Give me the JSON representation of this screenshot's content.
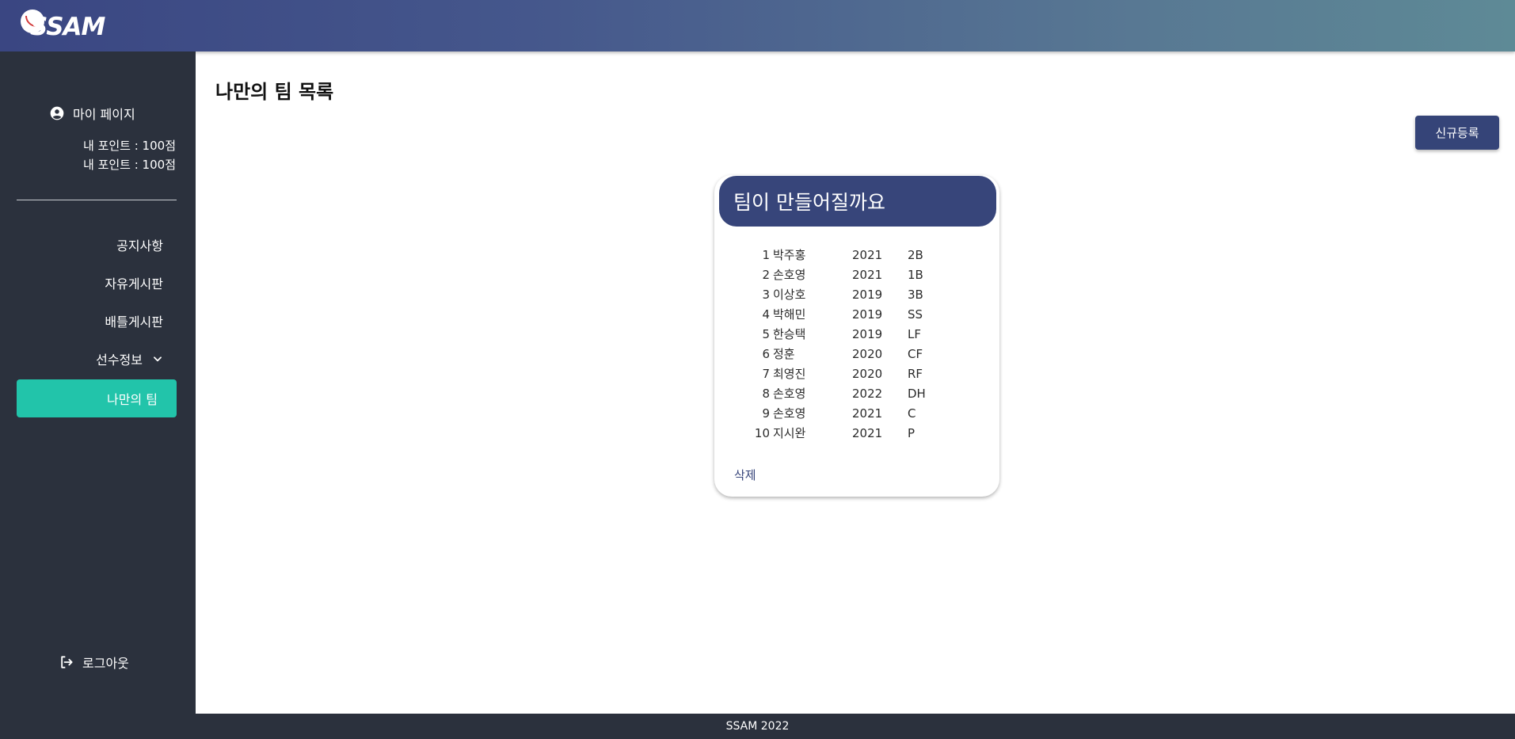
{
  "header": {
    "logo_text": "SSAM"
  },
  "sidebar": {
    "mypage_label": "마이 페이지",
    "points": [
      "내 포인트 : 100점",
      "내 포인트 : 100점"
    ],
    "items": [
      {
        "label": "공지사항"
      },
      {
        "label": "자유게시판"
      },
      {
        "label": "배틀게시판"
      },
      {
        "label": "선수정보"
      },
      {
        "label": "나만의 팀"
      }
    ],
    "logout_label": "로그아웃"
  },
  "main": {
    "title": "나만의 팀 목록",
    "new_button_label": "신규등록",
    "card": {
      "title": "팀이 만들어질까요",
      "players": [
        {
          "no": "1",
          "name": "박주홍",
          "year": "2021",
          "pos": "2B"
        },
        {
          "no": "2",
          "name": "손호영",
          "year": "2021",
          "pos": "1B"
        },
        {
          "no": "3",
          "name": "이상호",
          "year": "2019",
          "pos": "3B"
        },
        {
          "no": "4",
          "name": "박해민",
          "year": "2019",
          "pos": "SS"
        },
        {
          "no": "5",
          "name": "한승택",
          "year": "2019",
          "pos": "LF"
        },
        {
          "no": "6",
          "name": "정훈",
          "year": "2020",
          "pos": "CF"
        },
        {
          "no": "7",
          "name": "최영진",
          "year": "2020",
          "pos": "RF"
        },
        {
          "no": "8",
          "name": "손호영",
          "year": "2022",
          "pos": "DH"
        },
        {
          "no": "9",
          "name": "손호영",
          "year": "2021",
          "pos": "C"
        },
        {
          "no": "10",
          "name": "지시완",
          "year": "2021",
          "pos": "P"
        }
      ],
      "delete_label": "삭제"
    }
  },
  "footer": {
    "text": "SSAM 2022"
  },
  "colors": {
    "accent": "#22c4aa",
    "primary": "#37457a",
    "sidebar": "#2b313d"
  }
}
